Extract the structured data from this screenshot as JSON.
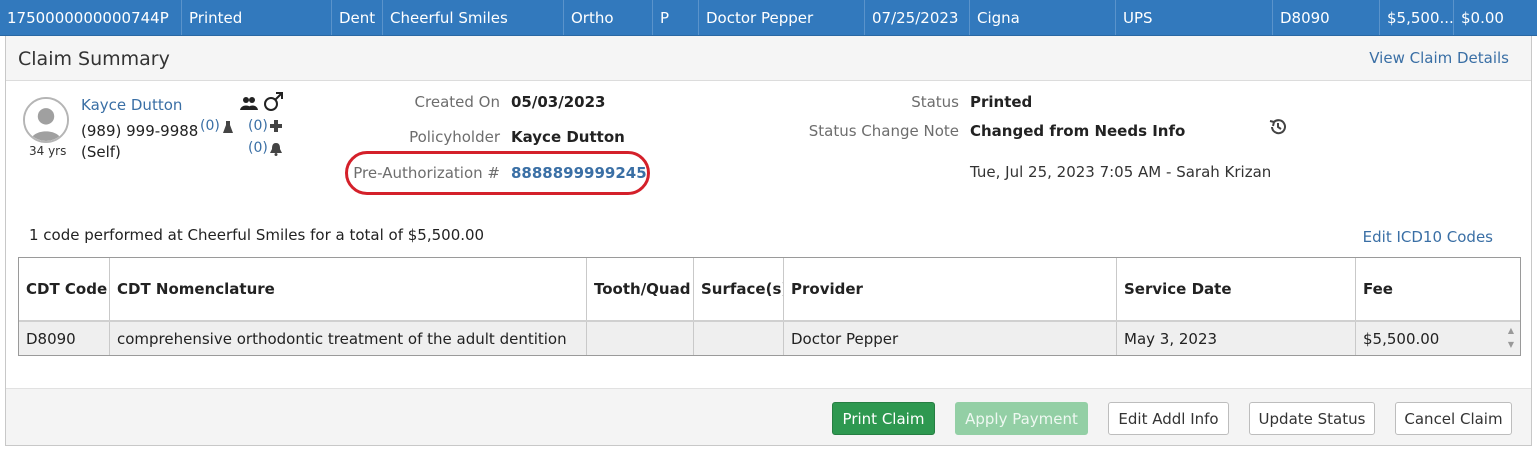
{
  "top_row": {
    "claim_number": "1750000000000744P",
    "status": "Printed",
    "type": "Dent",
    "location": "Cheerful Smiles",
    "specialty": "Ortho",
    "code": "P",
    "provider": "Doctor Pepper",
    "date": "07/25/2023",
    "carrier": "Cigna",
    "shipping": "UPS",
    "cdt": "D8090",
    "fee": "$5,500...",
    "balance": "$0.00"
  },
  "panel": {
    "title": "Claim Summary",
    "view_details_link": "View Claim Details"
  },
  "patient": {
    "name": "Kayce Dutton",
    "phone": "(989) 999-9988",
    "relationship": "(Self)",
    "age": "34 yrs",
    "lab_count": "(0)",
    "medical_count": "(0)",
    "alert_count": "(0)"
  },
  "details": {
    "created_on_label": "Created On",
    "created_on_value": "05/03/2023",
    "policyholder_label": "Policyholder",
    "policyholder_value": "Kayce Dutton",
    "preauth_label": "Pre-Authorization #",
    "preauth_value": "8888899999245",
    "status_label": "Status",
    "status_value": "Printed",
    "status_note_label": "Status Change Note",
    "status_note_value": "Changed from Needs Info",
    "status_note_time": "Tue, Jul 25, 2023 7:05 AM - Sarah Krizan"
  },
  "summary_text": "1 code performed at Cheerful Smiles for a total of $5,500.00",
  "edit_icd_link": "Edit ICD10 Codes",
  "table": {
    "headers": [
      "CDT Code",
      "CDT Nomenclature",
      "Tooth/Quad",
      "Surface(s)",
      "Provider",
      "Service Date",
      "Fee"
    ],
    "rows": [
      [
        "D8090",
        "comprehensive orthodontic treatment of the adult dentition",
        "",
        "",
        "Doctor Pepper",
        "May 3, 2023",
        "$5,500.00"
      ]
    ]
  },
  "buttons": {
    "print": "Print Claim",
    "apply": "Apply Payment",
    "edit_addl": "Edit Addl Info",
    "update_status": "Update Status",
    "cancel": "Cancel Claim"
  },
  "colors": {
    "header_blue": "#3279bd",
    "link_blue": "#3a6fa5",
    "print_green": "#2e9850",
    "highlight_red": "#d4202a"
  }
}
